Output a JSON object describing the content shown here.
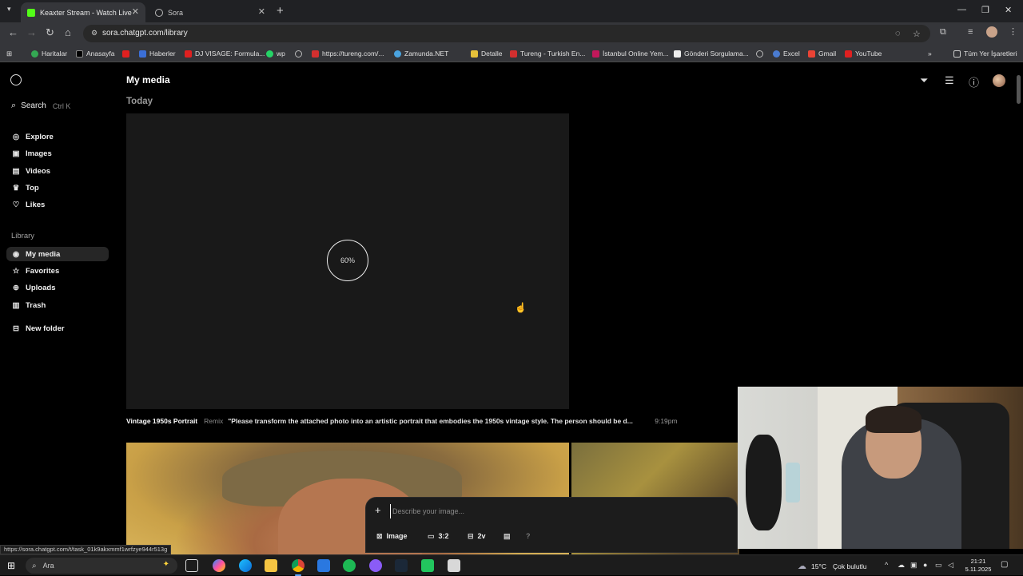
{
  "browser": {
    "tabs": [
      {
        "label": "Keaxter Stream - Watch Live on",
        "active": true
      },
      {
        "label": "Sora",
        "active": false
      }
    ],
    "url": "sora.chatgpt.com/library",
    "bookmarks": [
      "Haritalar",
      "Anasayfa",
      "Haberler",
      "DJ VISAGE: Formula...",
      "wp",
      "https://tureng.com/...",
      "Zamunda.NET",
      "Detalle",
      "Tureng - Turkish En...",
      "İstanbul Online Yem...",
      "Gönderi Sorgulama...",
      "Excel",
      "Gmail",
      "YouTube"
    ],
    "all_bookmarks": "Tüm Yer İşaretleri",
    "status_url": "https://sora.chatgpt.com/t/task_01k9akxmmf1wrfzye944r513g"
  },
  "sidebar": {
    "search_label": "Search",
    "search_shortcut": "Ctrl K",
    "nav": [
      "Explore",
      "Images",
      "Videos",
      "Top",
      "Likes"
    ],
    "library_label": "Library",
    "library": [
      "My media",
      "Favorites",
      "Uploads",
      "Trash"
    ],
    "new_folder": "New folder"
  },
  "main": {
    "title": "My media",
    "section": "Today",
    "progress": "60%",
    "progress_value": 0.6,
    "item": {
      "title": "Vintage 1950s Portrait",
      "kind": "Remix",
      "prompt": "\"Please transform the attached photo into an artistic portrait that embodies the 1950s vintage style. The person should be d...",
      "time": "9:19pm"
    }
  },
  "composer": {
    "placeholder": "Describe your image...",
    "type_label": "Image",
    "ratio_label": "3:2",
    "variations_label": "2v",
    "help_label": "?"
  },
  "taskbar": {
    "search_placeholder": "Ara",
    "weather_temp": "15°C",
    "weather_desc": "Çok bulutlu",
    "time": "21:21",
    "date": "5.11.2025"
  },
  "colors": {
    "page_bg": "#000000",
    "card_bg": "#191919",
    "kick_green": "#53fc18",
    "active_nav_bg": "#262626"
  }
}
